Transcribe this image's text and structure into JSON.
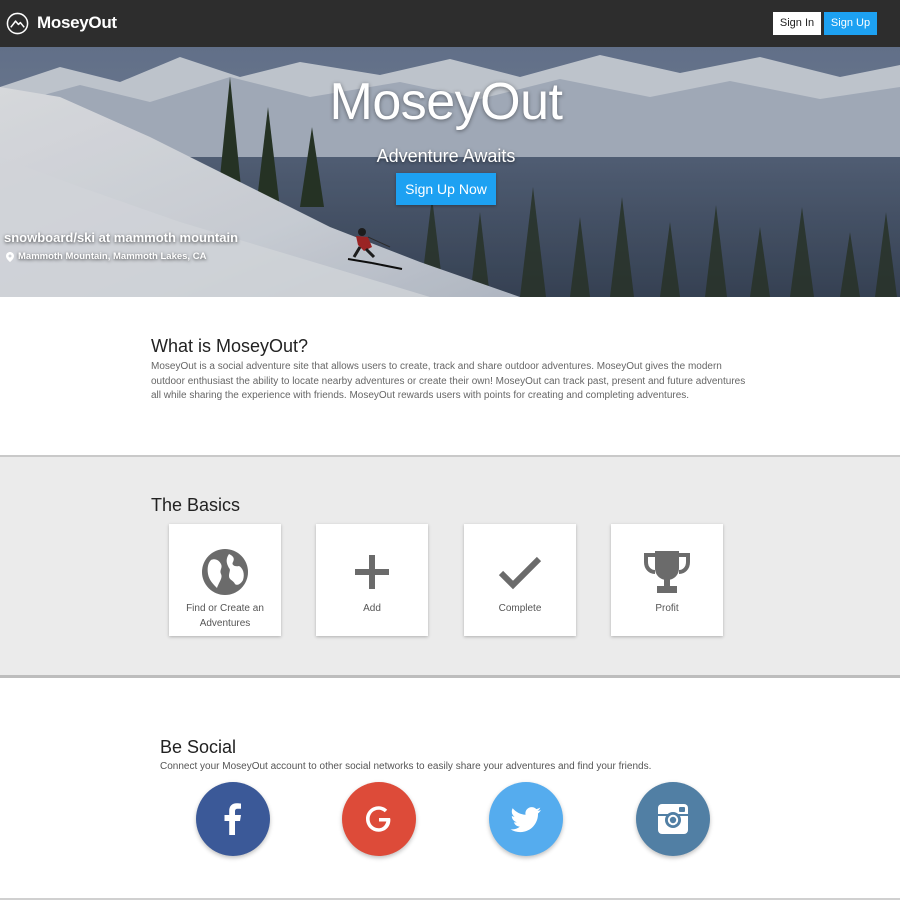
{
  "navbar": {
    "brand": "MoseyOut",
    "sign_in": "Sign In",
    "sign_up": "Sign Up",
    "logo_icon": "mountain-circle-icon"
  },
  "hero": {
    "title": "MoseyOut",
    "subtitle": "Adventure Awaits",
    "cta": "Sign Up Now",
    "photo_title": "snowboard/ski at mammoth mountain",
    "photo_location": "Mammoth Mountain, Mammoth Lakes, CA",
    "location_icon": "map-pin-icon"
  },
  "about": {
    "heading": "What is MoseyOut?",
    "body": "MoseyOut is a social adventure site that allows users to create, track and share outdoor adventures. MoseyOut gives the modern outdoor enthusiast the ability to locate nearby adventures or create their own! MoseyOut can track past, present and future adventures all while sharing the experience with friends. MoseyOut rewards users with points for creating and completing adventures."
  },
  "basics": {
    "heading": "The Basics",
    "cards": [
      {
        "label": "Find or Create an Adventures",
        "icon": "globe-icon"
      },
      {
        "label": "Add",
        "icon": "plus-icon"
      },
      {
        "label": "Complete",
        "icon": "checkmark-icon"
      },
      {
        "label": "Profit",
        "icon": "trophy-icon"
      }
    ]
  },
  "social": {
    "heading": "Be Social",
    "description": "Connect your MoseyOut account to other social networks to easily share your adventures and find your friends.",
    "networks": [
      {
        "name": "facebook",
        "icon": "facebook-icon",
        "color": "#3b5998"
      },
      {
        "name": "google",
        "icon": "google-icon",
        "color": "#dd4b39"
      },
      {
        "name": "twitter",
        "icon": "twitter-icon",
        "color": "#55acee"
      },
      {
        "name": "instagram",
        "icon": "instagram-icon",
        "color": "#517fa4"
      }
    ]
  },
  "colors": {
    "navbar": "#2d2d2d",
    "accent": "#1da1f2",
    "icon_gray": "#6b6b6b",
    "section_gray": "#ebebeb"
  }
}
